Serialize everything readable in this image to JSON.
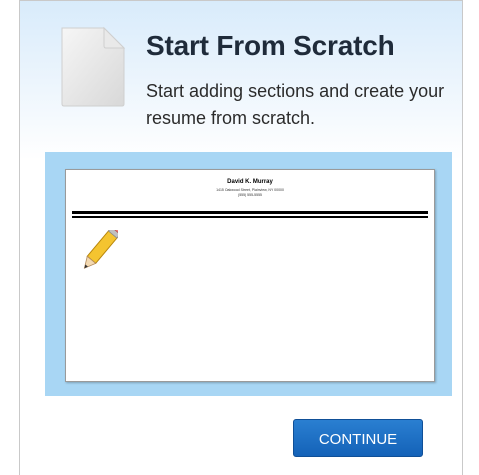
{
  "card": {
    "title": "Start From Scratch",
    "description": "Start adding sections and create your resume from scratch.",
    "icon": "blank-document-icon"
  },
  "preview": {
    "name": "David K. Murray",
    "address": "1415 Oakwood Street, Plainview, NY 00000",
    "phone": "(555) 555-5555",
    "icon": "pencil-icon"
  },
  "actions": {
    "continue_label": "CONTINUE"
  },
  "colors": {
    "title": "#1f2b3a",
    "preview_frame": "#a8d6f4",
    "button": "#1a6fc4"
  }
}
